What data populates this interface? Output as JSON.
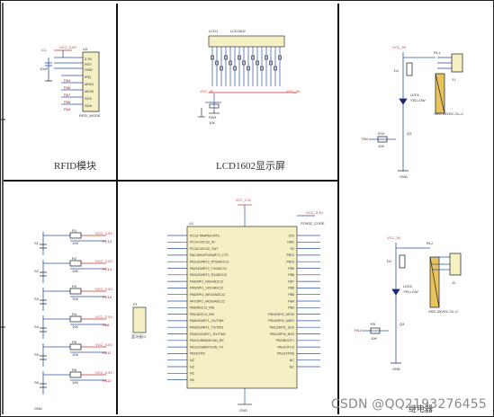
{
  "panels": {
    "rfid": {
      "title": "RFID模块",
      "module_label": "RFID_MODE",
      "cap": "C1",
      "cap_val": "10uF",
      "vcc": "VCC_3.3V",
      "conn": "U3",
      "pins": [
        "3.3V",
        "RST",
        "GND",
        "IRQ",
        "MISO",
        "MOSI",
        "SCK",
        "SDA"
      ],
      "nets": [
        "PA4",
        "PA6",
        "PA7",
        "PA5",
        "PA3"
      ]
    },
    "lcd": {
      "title": "LCD1602显示屏",
      "ref": "LCD1",
      "part": "LCD1602",
      "vcc": "VCC_5V",
      "pot": "RW1",
      "pot_val": "10K"
    },
    "relay_top": {
      "vcc": "VCC_5V",
      "relay": "RL1",
      "diode": "D1",
      "led": "LED1",
      "led_val": "YELLOW",
      "res": "R10",
      "res_val": "10K",
      "tr": "Q3",
      "net": "PA0",
      "out": "J1",
      "module": "SRD-05VDC-SL-C",
      "gnd": "GND"
    },
    "keys": {
      "vcc": "VCC_3.3V",
      "resistors": [
        "R1",
        "R2",
        "R3",
        "R4",
        "R5",
        "R6"
      ],
      "res_val": "10K",
      "switches": [
        "S1",
        "S2",
        "S3",
        "S4",
        "S5",
        "S6"
      ],
      "nets": [
        "PC13",
        "PC14",
        "PC15",
        "PA8",
        "PA11",
        "PA12"
      ],
      "gnd": "GND"
    },
    "mcu": {
      "vcc": "VCC_3.3V",
      "chip": "STM32_CORE",
      "ref": "U1",
      "left_pins": [
        "PC13-TAMPER-RTC",
        "PC14-OSC32_IN",
        "PC15-OSC32_OUT",
        "PA0-WKUP/USART2_CTS",
        "PA1/USART2_RTS/ADC12",
        "PA2/USART2_TX/ADC12",
        "PA3/USART2_RX/ADC12",
        "PA4/SPI1_NSS/ADC12",
        "PA5/SPI1_SCK/ADC12",
        "PA6/SPI1_MISO/ADC12",
        "PA7/SPI1_MOSI/ADC12",
        "PB0/ADC12_IN8",
        "PB1/ADC12_IN9",
        "PA8/USART1_CK/TIM1",
        "PA9/USART1_TX/TIM1",
        "PA10/USART1_RX/TIM1",
        "PA11/USBDM/CAN_RX",
        "PA12/USBDP/CAN_TX",
        "PA15/JTDI",
        "NC",
        "NC",
        "NC",
        "NC"
      ],
      "right_pins": [
        "3V3",
        "GND",
        "5V",
        "PB11",
        "PB10",
        "PB9",
        "PB8",
        "PB7",
        "PB6",
        "PB5",
        "PB4",
        "PB3",
        "PB15/SPI2_MOSI",
        "PB14/SPI2_MISO",
        "PB13/SPI2_SCK",
        "PB12/SPI2_NSS",
        "PB2/BOOT1",
        "PA14/JTCK",
        "PA13/JTMS",
        "NC",
        "NC"
      ],
      "port": "P1",
      "port_label": "蓝牙接口",
      "gnd": "GND"
    },
    "relay_bot": {
      "vcc": "VCC_5V",
      "relay": "RL2",
      "diode": "D2",
      "led": "LED2",
      "led_val": "YELLOW",
      "res": "R9",
      "res_val": "10K",
      "tr": "Q4",
      "net": "PA1",
      "out": "J2",
      "module": "SRD-05VDC-SL-C",
      "gnd": "GND",
      "title": "继电器"
    }
  },
  "watermark": "CSDN @QQ2193276455"
}
